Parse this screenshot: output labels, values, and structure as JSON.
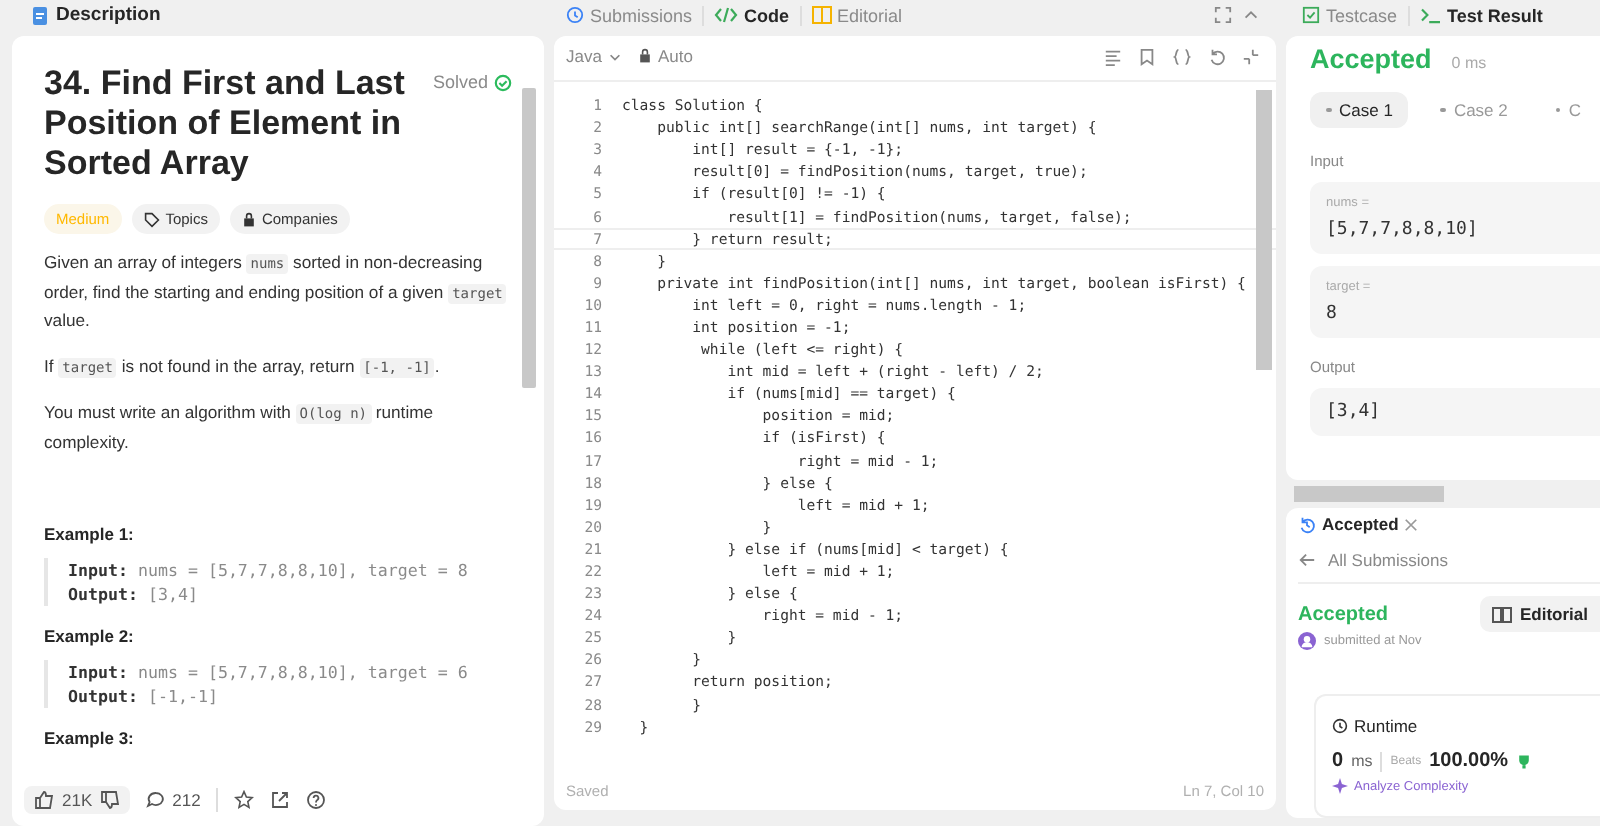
{
  "description_panel": {
    "tab": "Description",
    "title": "34. Find First and Last Position of Element in Sorted Array",
    "status": "Solved",
    "difficulty": "Medium",
    "tags": [
      "Topics",
      "Companies"
    ],
    "paragraphs": [
      [
        {
          "kind": "text",
          "text": "Given an array of integers "
        },
        {
          "kind": "code",
          "text": "nums"
        },
        {
          "kind": "text",
          "text": " sorted in non-decreasing order, find the starting and ending position of a given "
        },
        {
          "kind": "code",
          "text": "target"
        },
        {
          "kind": "text",
          "text": " value."
        }
      ],
      [
        {
          "kind": "text",
          "text": "If "
        },
        {
          "kind": "code",
          "text": "target"
        },
        {
          "kind": "text",
          "text": " is not found in the array, return "
        },
        {
          "kind": "code",
          "text": "[-1, -1]"
        },
        {
          "kind": "text",
          "text": "."
        }
      ],
      [
        {
          "kind": "text",
          "text": "You must write an algorithm with "
        },
        {
          "kind": "code",
          "text": "O(log n)"
        },
        {
          "kind": "text",
          "text": " runtime complexity."
        }
      ]
    ],
    "examples": [
      {
        "heading": "Example 1:",
        "input_label": "Input:",
        "input": "nums = [5,7,7,8,8,10], target = 8",
        "output_label": "Output:",
        "output": "[3,4]"
      },
      {
        "heading": "Example 2:",
        "input_label": "Input:",
        "input": "nums = [5,7,7,8,8,10], target = 6",
        "output_label": "Output:",
        "output": "[-1,-1]"
      },
      {
        "heading": "Example 3:"
      }
    ],
    "likes": "21K",
    "comments": "212"
  },
  "editor": {
    "tabs": [
      {
        "label": "Submissions",
        "selected": false
      },
      {
        "label": "Code",
        "selected": true
      },
      {
        "label": "Editorial",
        "selected": false
      }
    ],
    "language": "Java",
    "mode": "Auto",
    "lines": [
      "class Solution {",
      "    public int[] searchRange(int[] nums, int target) {",
      "        int[] result = {-1, -1};",
      "        result[0] = findPosition(nums, target, true);",
      "        if (result[0] != -1) {",
      "            result[1] = findPosition(nums, target, false);",
      "        } return result;",
      "    }",
      "    private int findPosition(int[] nums, int target, boolean isFirst) {",
      "        int left = 0, right = nums.length - 1;",
      "        int position = -1;",
      "         while (left <= right) {",
      "            int mid = left + (right - left) / 2;",
      "            if (nums[mid] == target) {",
      "                position = mid;",
      "                if (isFirst) {",
      "                    right = mid - 1;",
      "                } else {",
      "                    left = mid + 1;",
      "                }",
      "            } else if (nums[mid] < target) {",
      "                left = mid + 1;",
      "            } else {",
      "                right = mid - 1;",
      "            }",
      "        }",
      "        return position;",
      "        }",
      "  }"
    ],
    "line_numbers": [
      "1",
      "2",
      "3",
      "4",
      "5",
      "6",
      "7",
      "8",
      "9",
      "10",
      "11",
      "12",
      "13",
      "14",
      "15",
      "16",
      "17",
      "18",
      "19",
      "20",
      "21",
      "22",
      "23",
      "24",
      "25",
      "26",
      "27",
      "28",
      "29"
    ],
    "save_status": "Saved",
    "cursor": "Ln 7, Col 10"
  },
  "test_result": {
    "tabs": [
      {
        "label": "Testcase",
        "selected": false
      },
      {
        "label": "Test Result",
        "selected": true
      }
    ],
    "verdict": "Accepted",
    "runtime": "0 ms",
    "cases": [
      {
        "label": "Case 1",
        "selected": true
      },
      {
        "label": "Case 2",
        "selected": false
      },
      {
        "label": "C",
        "selected": false
      }
    ],
    "input_label": "Input",
    "params": [
      {
        "name": "nums =",
        "value": "[5,7,7,8,8,10]"
      },
      {
        "name": "target =",
        "value": "8"
      }
    ],
    "output_label": "Output",
    "output": "[3,4]"
  },
  "submission": {
    "tab": "Accepted",
    "back": "All Submissions",
    "verdict": "Accepted",
    "submitted": "submitted at Nov",
    "editorial": "Editorial",
    "runtime_label": "Runtime",
    "runtime_value": "0",
    "runtime_unit": "ms",
    "beats_label": "Beats",
    "beats": "100.00%",
    "analyze": "Analyze Complexity"
  }
}
